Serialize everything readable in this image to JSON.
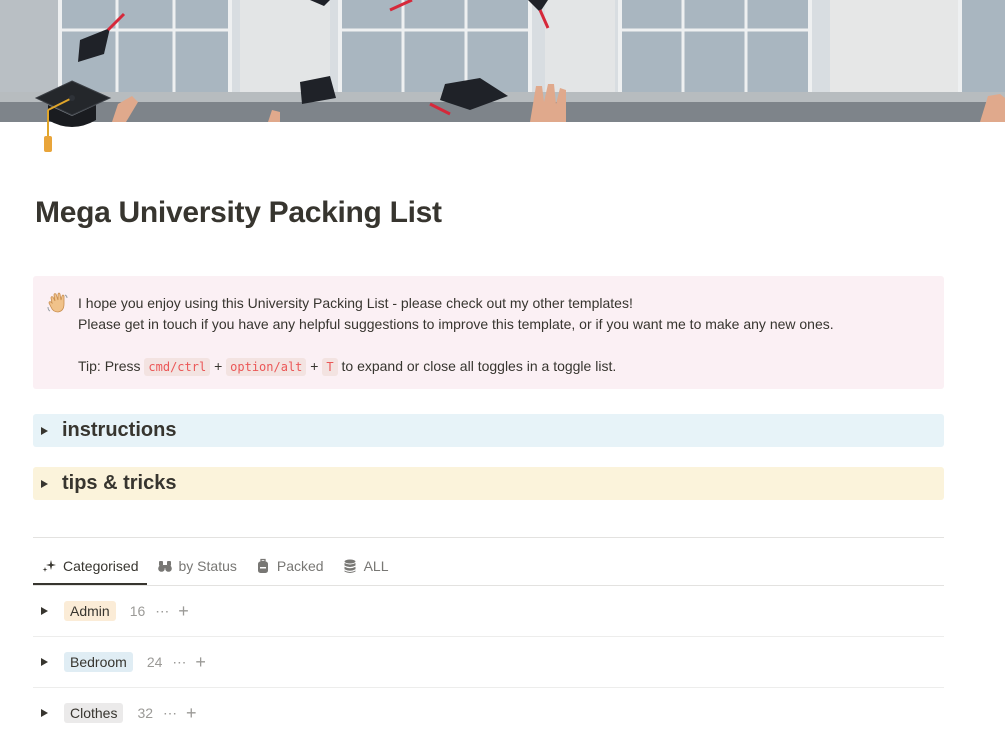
{
  "page": {
    "title": "Mega University Packing List"
  },
  "callout": {
    "line1": "I hope you enjoy using this University Packing List - please check out my other templates!",
    "line2": "Please get in touch if you have any helpful suggestions to improve this template, or if you want me to make any new ones.",
    "tip_prefix": "Tip: Press ",
    "key1": "cmd/ctrl",
    "plus1": " + ",
    "key2": "option/alt",
    "plus2": " + ",
    "key3": "T",
    "tip_suffix": " to expand or close all toggles in a toggle list.",
    "background": "#fbf0f4"
  },
  "toggles": [
    {
      "label": "instructions",
      "color": "#e7f3f8"
    },
    {
      "label": "tips & tricks",
      "color": "#fbf3db"
    }
  ],
  "views": {
    "tabs": [
      {
        "label": "Categorised",
        "icon": "sparkles-icon",
        "active": true
      },
      {
        "label": "by Status",
        "icon": "binoculars-icon",
        "active": false
      },
      {
        "label": "Packed",
        "icon": "backpack-icon",
        "active": false
      },
      {
        "label": "ALL",
        "icon": "database-icon",
        "active": false
      }
    ]
  },
  "groups": [
    {
      "label": "Admin",
      "count": "16",
      "color": "#fbecd7",
      "more": "⋯",
      "add": "+"
    },
    {
      "label": "Bedroom",
      "count": "24",
      "color": "#e0edf4",
      "more": "⋯",
      "add": "+"
    },
    {
      "label": "Clothes",
      "count": "32",
      "color": "#ebeaea",
      "more": "⋯",
      "add": "+"
    }
  ]
}
